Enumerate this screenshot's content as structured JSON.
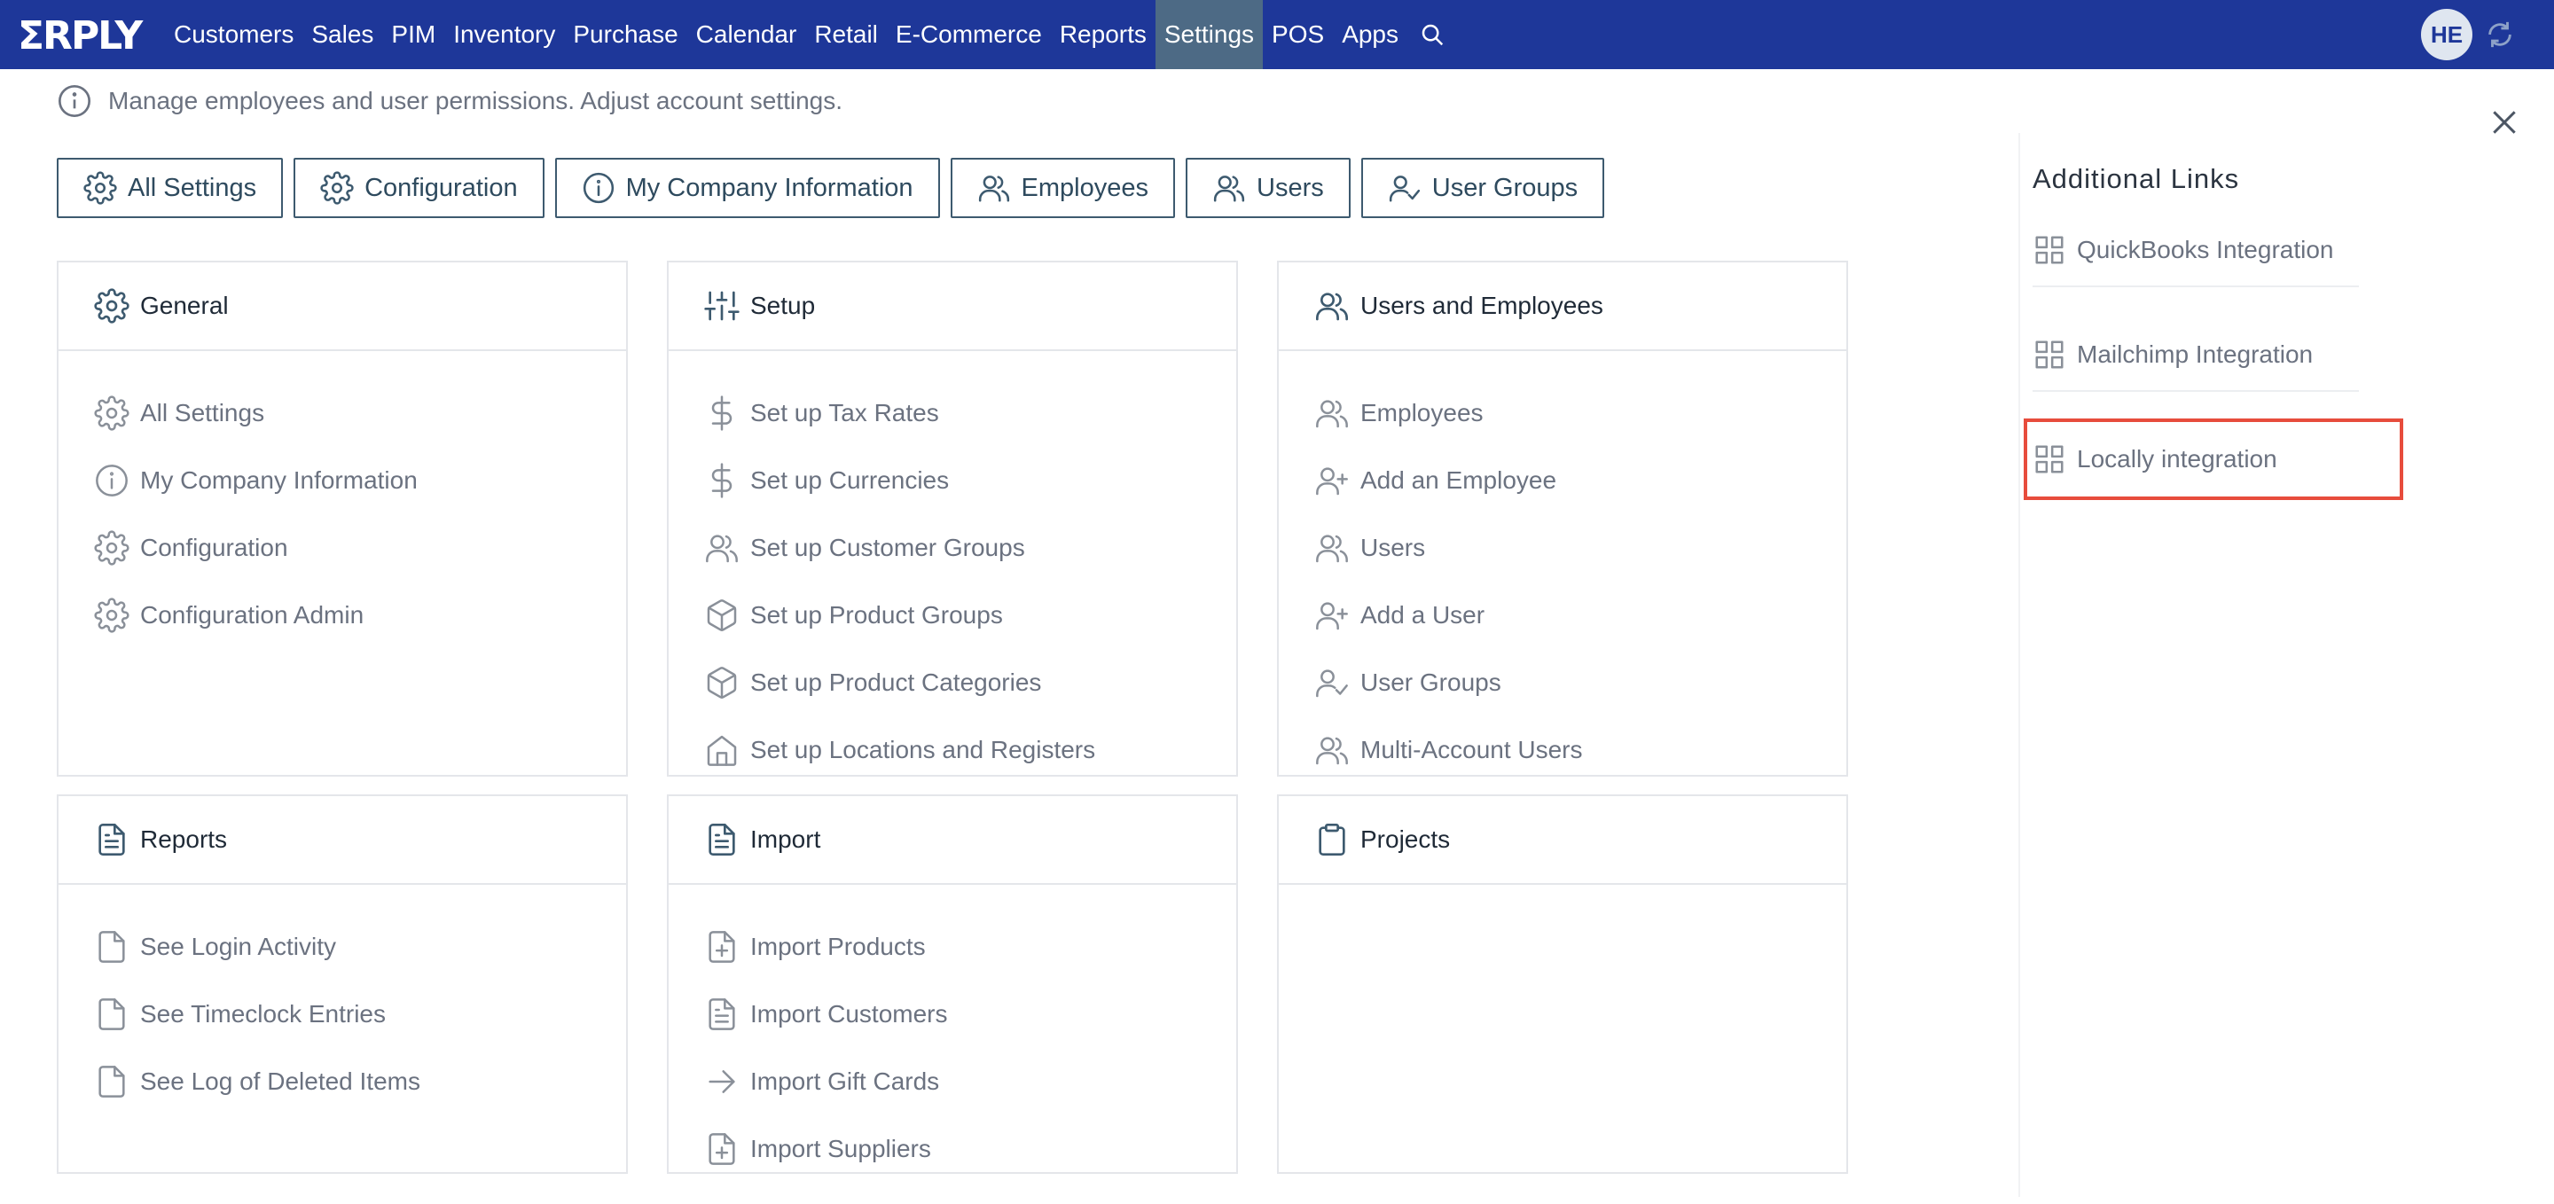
{
  "colors": {
    "nav_bg": "#1e3799",
    "nav_active": "#4d6a85",
    "highlight": "#e74c3c",
    "muted_text": "#6b7280"
  },
  "topnav": {
    "logo_text": "ERPLY",
    "items": [
      "Customers",
      "Sales",
      "PIM",
      "Inventory",
      "Purchase",
      "Calendar",
      "Retail",
      "E-Commerce",
      "Reports",
      "Settings",
      "POS",
      "Apps"
    ],
    "active": "Settings",
    "avatar": "HE"
  },
  "info": {
    "text": "Manage employees and user permissions. Adjust account settings."
  },
  "quick_buttons": [
    {
      "label": "All Settings",
      "icon": "gear-icon"
    },
    {
      "label": "Configuration",
      "icon": "gear-icon"
    },
    {
      "label": "My Company Information",
      "icon": "info-icon"
    },
    {
      "label": "Employees",
      "icon": "users-icon"
    },
    {
      "label": "Users",
      "icon": "users-icon"
    },
    {
      "label": "User Groups",
      "icon": "user-check-icon"
    }
  ],
  "cards": {
    "general": {
      "title": "General",
      "icon": "gear-icon",
      "items": [
        {
          "label": "All Settings",
          "icon": "gear-icon"
        },
        {
          "label": "My Company Information",
          "icon": "info-icon"
        },
        {
          "label": "Configuration",
          "icon": "gear-icon"
        },
        {
          "label": "Configuration Admin",
          "icon": "gear-icon"
        }
      ]
    },
    "setup": {
      "title": "Setup",
      "icon": "sliders-icon",
      "items": [
        {
          "label": "Set up Tax Rates",
          "icon": "dollar-icon"
        },
        {
          "label": "Set up Currencies",
          "icon": "dollar-icon"
        },
        {
          "label": "Set up Customer Groups",
          "icon": "users-icon"
        },
        {
          "label": "Set up Product Groups",
          "icon": "box-icon"
        },
        {
          "label": "Set up Product Categories",
          "icon": "box-icon"
        },
        {
          "label": "Set up Locations and Registers",
          "icon": "home-icon"
        }
      ]
    },
    "users_employees": {
      "title": "Users and Employees",
      "icon": "users-icon",
      "items": [
        {
          "label": "Employees",
          "icon": "users-icon"
        },
        {
          "label": "Add an Employee",
          "icon": "user-plus-icon"
        },
        {
          "label": "Users",
          "icon": "users-icon"
        },
        {
          "label": "Add a User",
          "icon": "user-plus-icon"
        },
        {
          "label": "User Groups",
          "icon": "user-check-icon"
        },
        {
          "label": "Multi-Account Users",
          "icon": "users-icon"
        }
      ]
    },
    "reports": {
      "title": "Reports",
      "icon": "document-icon",
      "items": [
        {
          "label": "See Login Activity",
          "icon": "file-icon"
        },
        {
          "label": "See Timeclock Entries",
          "icon": "file-icon"
        },
        {
          "label": "See Log of Deleted Items",
          "icon": "file-icon"
        }
      ]
    },
    "import": {
      "title": "Import",
      "icon": "document-icon",
      "items": [
        {
          "label": "Import Products",
          "icon": "file-plus-icon"
        },
        {
          "label": "Import Customers",
          "icon": "document-icon"
        },
        {
          "label": "Import Gift Cards",
          "icon": "arrow-right-icon"
        },
        {
          "label": "Import Suppliers",
          "icon": "file-plus-icon"
        }
      ]
    },
    "projects": {
      "title": "Projects",
      "icon": "clipboard-icon",
      "items": []
    }
  },
  "additional_links": {
    "title": "Additional Links",
    "items": [
      {
        "label": "QuickBooks Integration",
        "icon": "grid-icon"
      },
      {
        "label": "Mailchimp Integration",
        "icon": "grid-icon"
      },
      {
        "label": "Locally integration",
        "icon": "grid-icon"
      }
    ]
  }
}
